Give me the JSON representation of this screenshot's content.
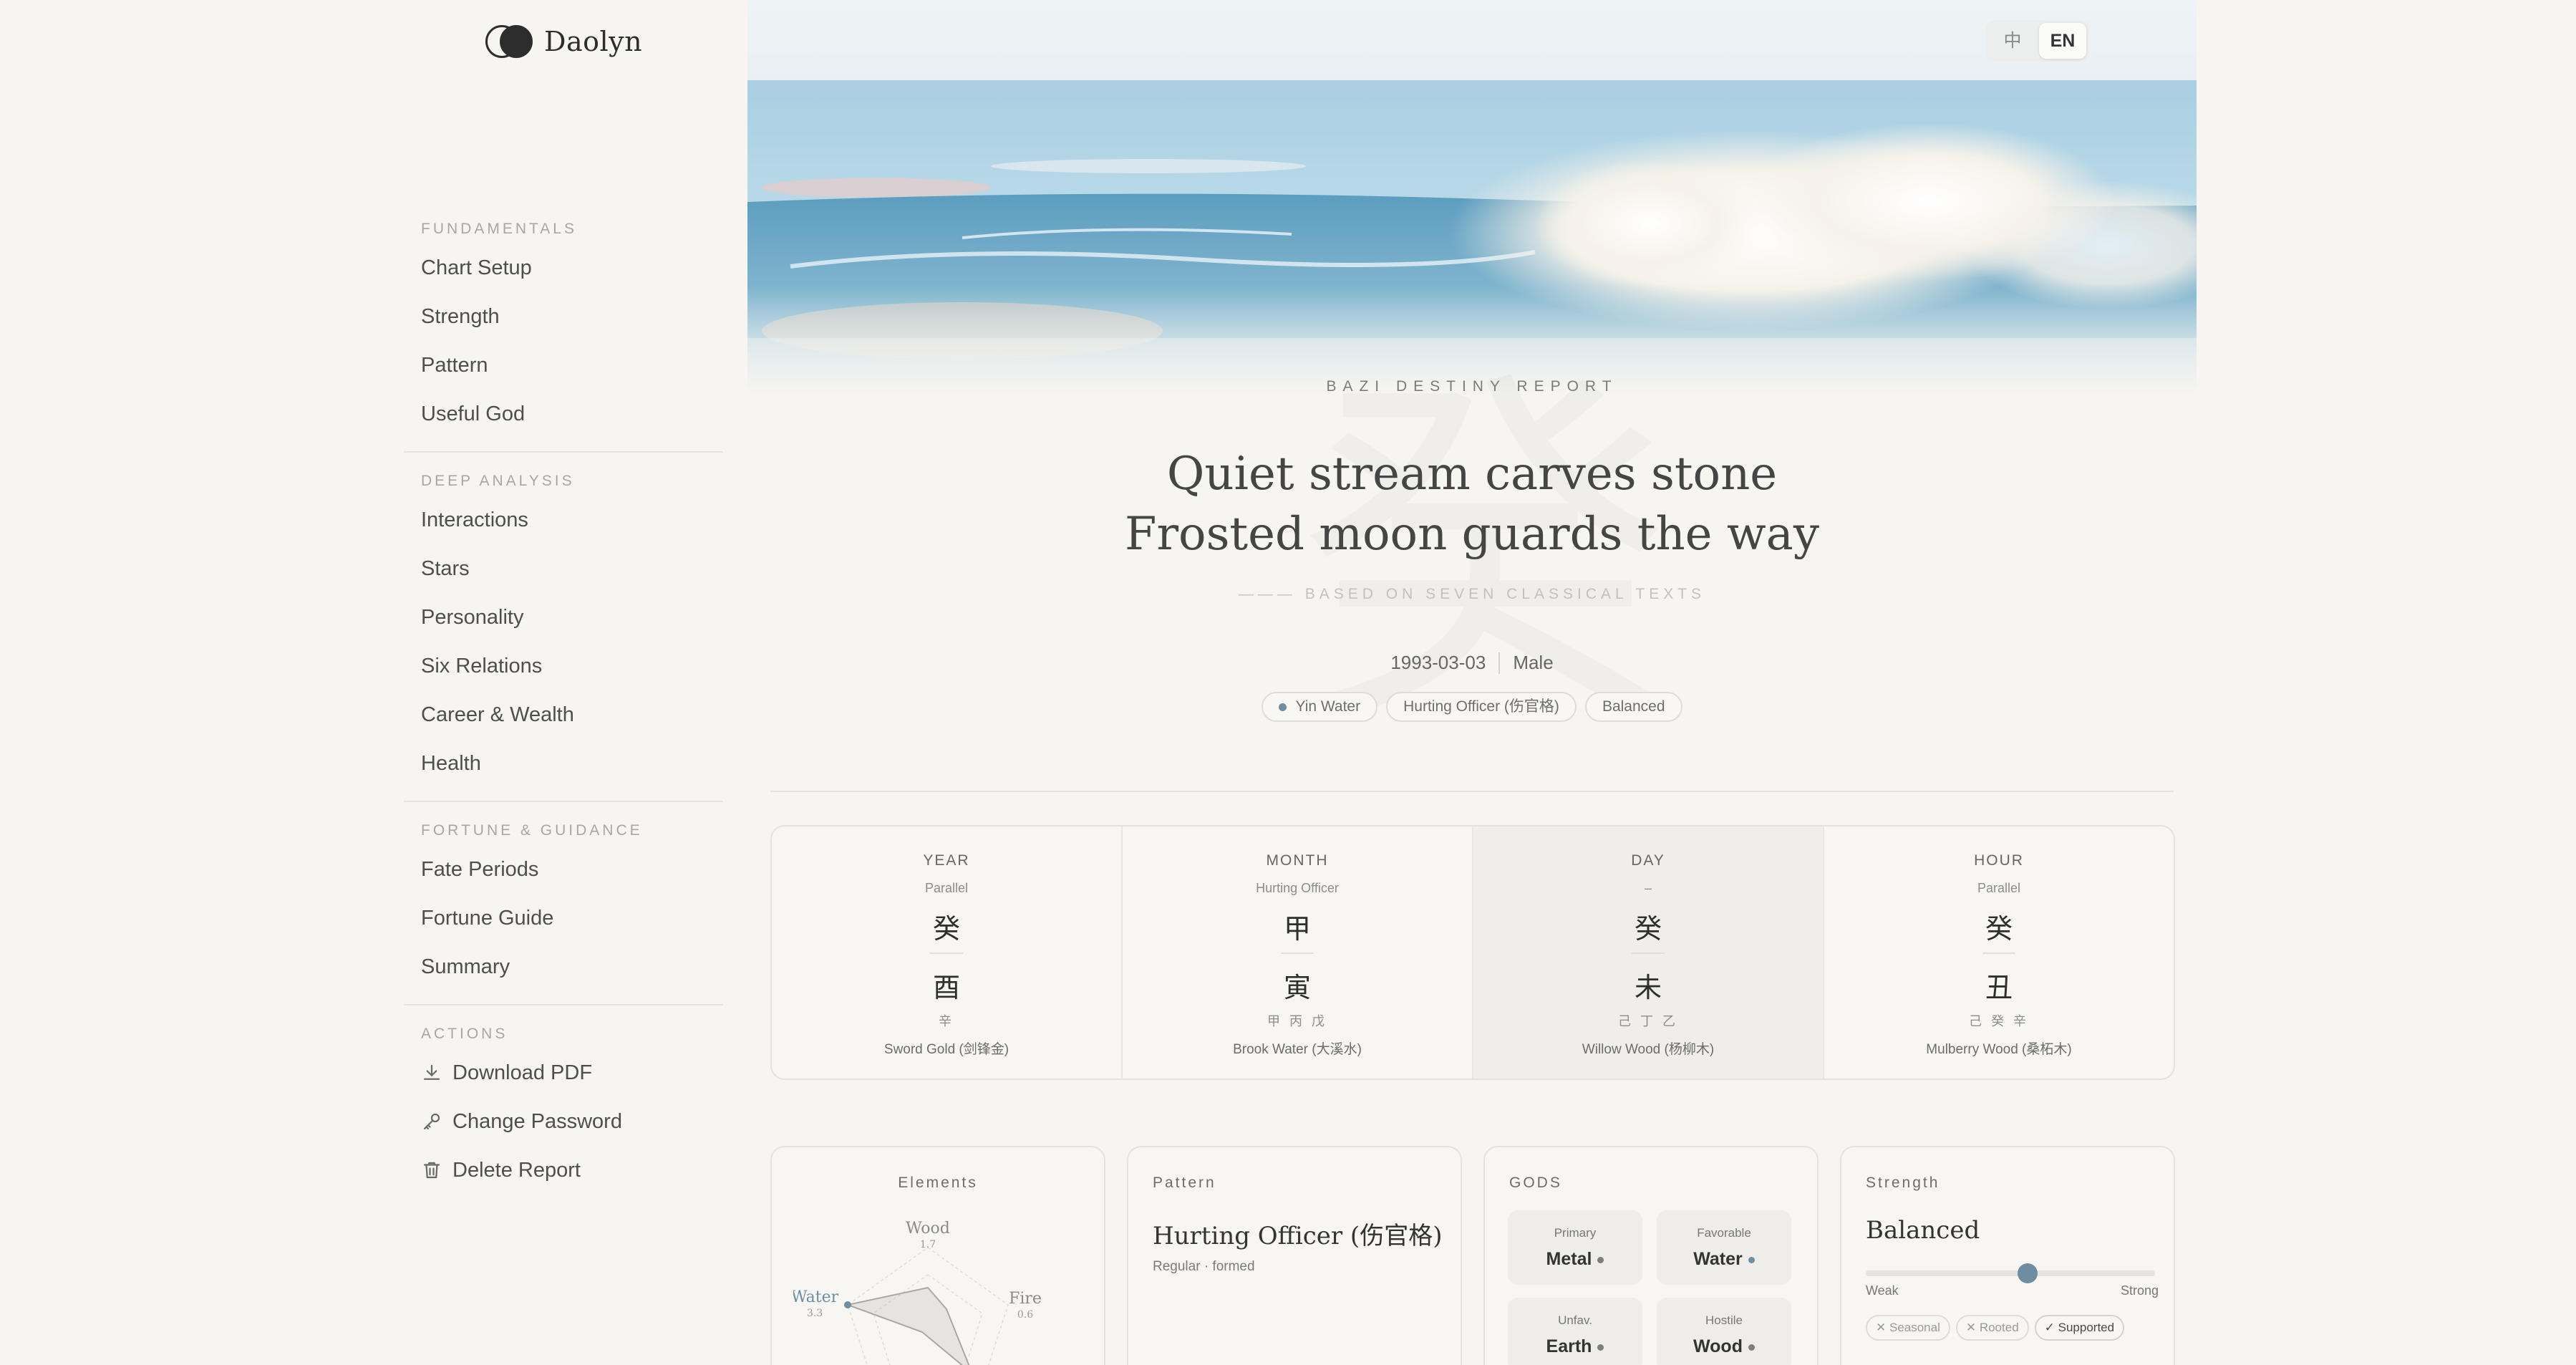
{
  "brand": {
    "name": "Daolyn"
  },
  "language": {
    "zh": "中",
    "en": "EN",
    "active": "en"
  },
  "sidebar": {
    "sections": [
      {
        "heading": "FUNDAMENTALS",
        "items": [
          "Chart Setup",
          "Strength",
          "Pattern",
          "Useful God"
        ]
      },
      {
        "heading": "DEEP ANALYSIS",
        "items": [
          "Interactions",
          "Stars",
          "Personality",
          "Six Relations",
          "Career & Wealth",
          "Health"
        ]
      },
      {
        "heading": "FORTUNE & GUIDANCE",
        "items": [
          "Fate Periods",
          "Fortune Guide",
          "Summary"
        ]
      }
    ],
    "actions": {
      "heading": "ACTIONS",
      "download": "Download PDF",
      "password": "Change Password",
      "delete": "Delete Report"
    }
  },
  "report": {
    "kicker": "BAZI DESTINY REPORT",
    "title_line1": "Quiet stream carves stone",
    "title_line2": "Frosted moon guards the way",
    "subline": "——— BASED ON SEVEN CLASSICAL TEXTS",
    "bg_glyph": "癸",
    "birth_date": "1993-03-03",
    "gender": "Male",
    "tags": [
      "Yin Water",
      "Hurting Officer (伤官格)",
      "Balanced"
    ]
  },
  "pillars": [
    {
      "label": "YEAR",
      "god": "Parallel",
      "stem": "癸",
      "branch": "酉",
      "hidden": "辛",
      "nayin": "Sword Gold (剑锋金)",
      "highlight": false
    },
    {
      "label": "MONTH",
      "god": "Hurting Officer",
      "stem": "甲",
      "branch": "寅",
      "hidden": "甲 丙 戊",
      "nayin": "Brook Water (大溪水)",
      "highlight": false
    },
    {
      "label": "DAY",
      "god": "–",
      "stem": "癸",
      "branch": "未",
      "hidden": "己 丁 乙",
      "nayin": "Willow Wood (杨柳木)",
      "highlight": true
    },
    {
      "label": "HOUR",
      "god": "Parallel",
      "stem": "癸",
      "branch": "丑",
      "hidden": "己 癸 辛",
      "nayin": "Mulberry Wood (桑柘木)",
      "highlight": false
    }
  ],
  "elements": {
    "heading": "Elements",
    "wood": {
      "label": "Wood",
      "value": "1.7"
    },
    "fire": {
      "label": "Fire",
      "value": "0.6"
    },
    "water": {
      "label": "Water",
      "value": "3.3"
    }
  },
  "pattern": {
    "heading": "Pattern",
    "name": "Hurting Officer (伤官格)",
    "sub": "Regular · formed"
  },
  "gods": {
    "heading": "GODS",
    "items": [
      {
        "key": "Primary",
        "value": "Metal",
        "dot": "#7d7d7d"
      },
      {
        "key": "Favorable",
        "value": "Water",
        "dot": "#6f8da1"
      },
      {
        "key": "Unfav.",
        "value": "Earth",
        "dot": "#7d7d7d"
      },
      {
        "key": "Hostile",
        "value": "Wood",
        "dot": "#7d7d7d"
      }
    ]
  },
  "strength": {
    "heading": "Strength",
    "value": "Balanced",
    "level": 0.56,
    "weak": "Weak",
    "strong": "Strong",
    "chips": [
      "✕ Seasonal",
      "✕ Rooted",
      "✓ Supported"
    ]
  },
  "colors": {
    "accent": "#6f8da1",
    "background": "#f6f5f1"
  }
}
